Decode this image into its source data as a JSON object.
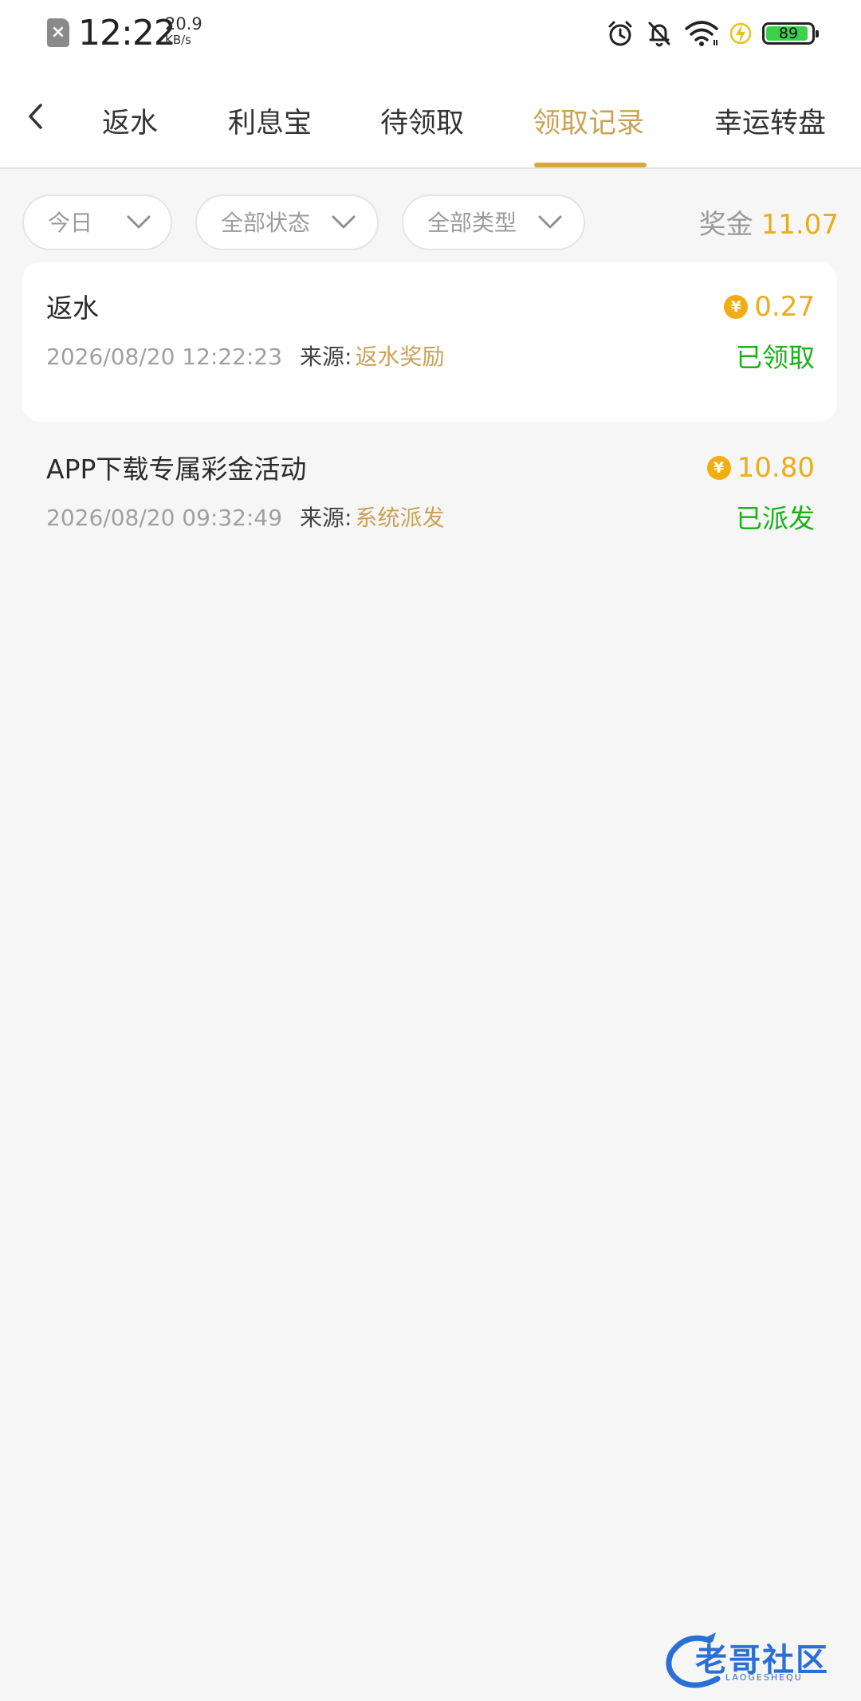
{
  "status_bar": {
    "time": "12:22",
    "net_speed": "20.9",
    "net_unit": "KB/s",
    "battery": "89",
    "icons": [
      "sim-off-icon",
      "alarm-icon",
      "mute-icon",
      "wifi-icon",
      "charging-icon",
      "battery-icon"
    ]
  },
  "header": {
    "back_icon": "chevron-left-icon",
    "tabs": [
      {
        "label": "返水",
        "active": false
      },
      {
        "label": "利息宝",
        "active": false
      },
      {
        "label": "待领取",
        "active": false
      },
      {
        "label": "领取记录",
        "active": true
      },
      {
        "label": "幸运转盘",
        "active": false
      }
    ]
  },
  "filters": {
    "date": "今日",
    "status": "全部状态",
    "type": "全部类型",
    "bonus_label": "奖金",
    "bonus_total": "11.07"
  },
  "records": [
    {
      "title": "返水",
      "time": "2026/08/20 12:22:23",
      "source_label": "来源:",
      "source": "返水奖励",
      "amount": "0.27",
      "status": "已领取"
    },
    {
      "title": "APP下载专属彩金活动",
      "time": "2026/08/20 09:32:49",
      "source_label": "来源:",
      "source": "系统派发",
      "amount": "10.80",
      "status": "已派发"
    }
  ],
  "coin_symbol": "¥",
  "watermark": {
    "text": "老哥社区",
    "sub": "LAOGESHEQU"
  },
  "colors": {
    "accent_gold": "#c9a256",
    "amount_orange": "#e9ad1a",
    "status_green": "#17b317",
    "background": "#f6f6f6"
  }
}
